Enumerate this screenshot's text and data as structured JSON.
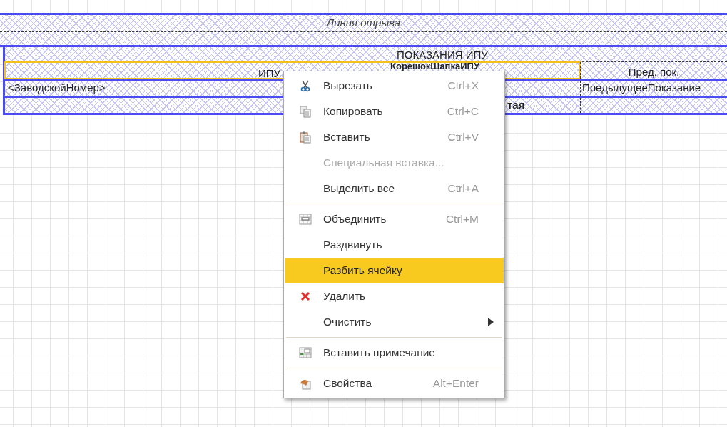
{
  "tear_line": {
    "label": "Линия отрыва"
  },
  "header": {
    "title": "ПОКАЗАНИЯ ИПУ",
    "overlay_label": "КорешокШапкаИПУ"
  },
  "header_cells": [
    {
      "text": "ИПУ",
      "selected": true
    },
    {
      "text": "Пред. пок.",
      "selected": false
    }
  ],
  "rows": [
    {
      "cells": [
        {
          "text": "<ЗаводскойНомер>",
          "bold": false
        },
        {
          "text": "ПредыдущееПоказание",
          "bold": false
        }
      ]
    },
    {
      "cells": [
        {
          "text": "тая",
          "bold": true
        },
        {}
      ]
    }
  ],
  "context_menu": [
    {
      "kind": "item",
      "label": "Вырезать",
      "shortcut": "Ctrl+X",
      "disabled": false,
      "selected": false
    },
    {
      "kind": "item",
      "label": "Копировать",
      "shortcut": "Ctrl+C",
      "disabled": false,
      "selected": false
    },
    {
      "kind": "item",
      "label": "Вставить",
      "shortcut": "Ctrl+V",
      "disabled": false,
      "selected": false
    },
    {
      "kind": "item",
      "label": "Специальная вставка...",
      "disabled": true,
      "selected": false
    },
    {
      "kind": "item",
      "label": "Выделить все",
      "shortcut": "Ctrl+A",
      "disabled": false,
      "selected": false
    },
    {
      "kind": "separator"
    },
    {
      "kind": "item",
      "label": "Объединить",
      "shortcut": "Ctrl+M",
      "disabled": false,
      "selected": false
    },
    {
      "kind": "item",
      "label": "Раздвинуть",
      "disabled": false,
      "selected": false
    },
    {
      "kind": "item",
      "label": "Разбить ячейку",
      "disabled": false,
      "selected": true
    },
    {
      "kind": "item",
      "label": "Удалить",
      "disabled": false,
      "selected": false
    },
    {
      "kind": "item",
      "label": "Очистить",
      "submenu": true,
      "disabled": false,
      "selected": false
    },
    {
      "kind": "separator"
    },
    {
      "kind": "item",
      "label": "Вставить примечание",
      "disabled": false,
      "selected": false
    },
    {
      "kind": "separator"
    },
    {
      "kind": "item",
      "label": "Свойства",
      "shortcut": "Alt+Enter",
      "disabled": false,
      "selected": false
    }
  ]
}
